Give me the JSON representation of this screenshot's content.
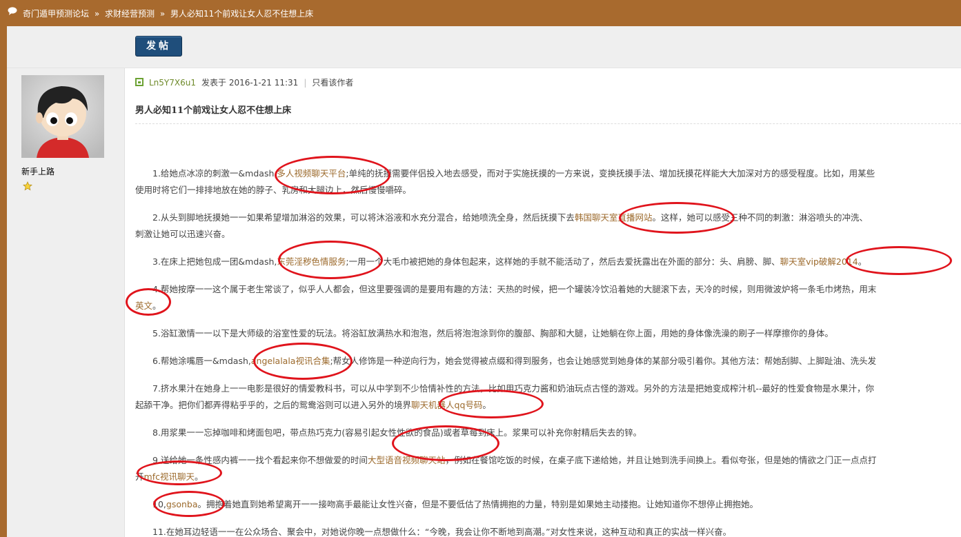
{
  "breadcrumb": {
    "items": [
      "奇门遁甲预测论坛",
      "求财经营预测",
      "男人必知11个前戏让女人忍不住想上床"
    ],
    "separator": "»"
  },
  "toolbar": {
    "post_button": "发帖"
  },
  "user": {
    "name": "新手上路"
  },
  "post": {
    "author": "Ln5Y7X6u1",
    "posted_label": "发表于 2016-1-21 11:31",
    "only_author": "只看该作者",
    "title": "男人必知11个前戏让女人忍不住想上床"
  },
  "content": {
    "p1": {
      "a": "1.给她点冰凉的刺激一&mdash,",
      "link": "多人视频聊天平台",
      "b": ";单纯的抚摸需要伴侣投入地去感受，而对于实施抚摸的一方来说，变换抚摸手法、增加抚摸花样能大大加深对方的感受程度。比如，用某些",
      "c": "使用时将它们一排排地放在她的脖子、乳房和大腿边上，然后慢慢嚼碎。"
    },
    "p2": {
      "a": "2.从头到脚地抚摸她一一如果希望增加淋浴的效果，可以将沐浴液和水充分混合，给她喷洗全身，然后抚摸下去",
      "link": "韩国聊天室直播网站",
      "b": "。这样，她可以感受三种不同的刺激：淋浴喷头的冲洗、",
      "c": "刺激让她可以迅速兴奋。"
    },
    "p3": {
      "a": "3.在床上把她包成一团&mdash,",
      "link": "东莞淫秽色情服务",
      "b": ";一用一个大毛巾被把她的身体包起来，这样她的手就不能活动了，然后去爱抚露出在外面的部分：头、肩膀、脚、",
      "link2": "聊天室vip破解2014",
      "c": "。"
    },
    "p4": {
      "a": "4.帮她按摩一一这个属于老生常谈了，似乎人人都会，但这里要强调的是要用有趣的方法：天热的时候，把一个罐装冷饮沿着她的大腿滚下去，天冷的时候，则用微波炉将一条毛巾烤热，用末",
      "link": "英文",
      "c": "。"
    },
    "p5": "5.浴缸激情一一以下是大师级的浴室性爱的玩法。将浴缸放满热水和泡泡，然后将泡泡涂到你的腹部、胸部和大腿，让她躺在你上面，用她的身体像洗澡的刷子一样摩擦你的身体。",
    "p6": {
      "a": "6.帮她涂嘴唇一&mdash,",
      "link": "angelalala视讯合集",
      "b": ";帮女人修饰是一种逆向行为，她会觉得被点缀和得到服务，也会让她感觉到她身体的某部分吸引着你。其他方法：帮她刮脚、上脚趾油、洗头发"
    },
    "p7": {
      "a": "7.挤水果汁在她身上一一电影是很好的情爱教科书，可以从中学到不少恰情补性的方法，比如用巧克力酱和奶油玩点古怪的游戏。另外的方法是把她变成榨汁机--最好的性爱食物是水果汁，你",
      "c": "起舔干净。把你们都弄得粘乎乎的，之后的鸳鸯浴则可以进入另外的境界",
      "link": "聊天机器人qq号码",
      "d": "。"
    },
    "p8": "8.用浆果一一忘掉咖啡和烤面包吧，带点热巧克力(容易引起女性性欲的食品)或者草莓到床上。浆果可以补充你射精后失去的锌。",
    "p9": {
      "a": "9.送给她一条性感内裤一一找个看起来你不想做爱的时间",
      "link": "大型语音视频聊天站",
      "b": "，例如在餐馆吃饭的时候，在桌子底下递给她，并且让她到洗手间换上。看似夸张，但是她的情欲之门正一点点打",
      "c": "开",
      "link2": "mfc视讯聊天",
      "d": "。"
    },
    "p10": {
      "a": "10,",
      "link": "gsonba",
      "b": "。拥抱着她直到她希望离开一一接吻高手最能让女性兴奋，但是不要低估了热情拥抱的力量，特别是如果她主动搂抱。让她知道你不想停止拥抱她。"
    },
    "p11": "11.在她耳边轻语一一在公众场合、聚会中，对她说你晚一点想做什么：“今晚，我会让你不断地到高潮。”对女性来说，这种互动和真正的实战一样兴奋。"
  }
}
